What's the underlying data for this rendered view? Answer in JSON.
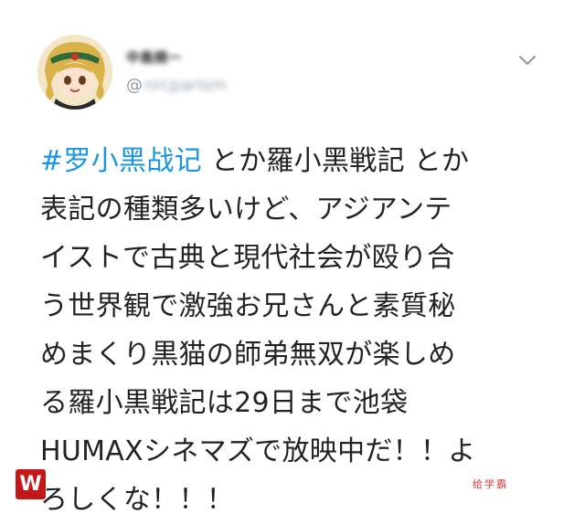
{
  "tweet": {
    "author": {
      "display_name": "中島規一",
      "handle_prefix": "@",
      "handle_blurred": "nrcparism"
    },
    "menu_icon": "chevron-down-icon",
    "hashtag": "#罗小黑战记",
    "lines": [
      " とか羅小黑戦記 とか",
      "表記の種類多いけど、アジアンテ",
      "イストで古典と現代社会が殴り合",
      "う世界観で激強お兄さんと素質秘",
      "めまくり黒猫の師弟無双が楽しめ",
      "る羅小黒戦記は29日まで池袋",
      "HUMAXシネマズで放映中だ！！よ",
      "ろしくな！！！"
    ]
  },
  "watermark": {
    "logo_letter": "W",
    "text": "给学霸"
  },
  "colors": {
    "hashtag": "#1b95e0",
    "text": "#1f2326",
    "muted": "#8b98a5",
    "watermark": "#c41818"
  }
}
